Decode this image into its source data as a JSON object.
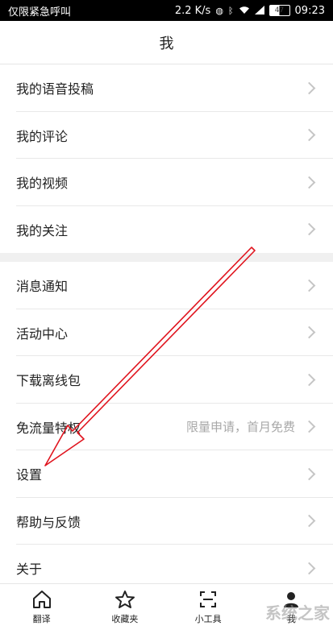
{
  "status_bar": {
    "carrier": "仅限紧急呼叫",
    "speed": "2.2 K/s",
    "battery": "47",
    "time": "09:23"
  },
  "header": {
    "title": "我"
  },
  "menu_group_1": [
    {
      "label": "我的语音投稿"
    },
    {
      "label": "我的评论"
    },
    {
      "label": "我的视频"
    },
    {
      "label": "我的关注"
    }
  ],
  "menu_group_2": [
    {
      "label": "消息通知",
      "sub": ""
    },
    {
      "label": "活动中心",
      "sub": ""
    },
    {
      "label": "下载离线包",
      "sub": ""
    },
    {
      "label": "免流量特权",
      "sub": "限量申请，首月免费"
    },
    {
      "label": "设置",
      "sub": ""
    },
    {
      "label": "帮助与反馈",
      "sub": ""
    },
    {
      "label": "关于",
      "sub": ""
    }
  ],
  "bottom_nav": [
    {
      "label": "翻译",
      "icon": "home-icon"
    },
    {
      "label": "收藏夹",
      "icon": "star-icon"
    },
    {
      "label": "小工具",
      "icon": "scan-icon"
    },
    {
      "label": "我",
      "icon": "profile-icon"
    }
  ],
  "watermark": "系统之家",
  "colors": {
    "arrow": "#e0141e",
    "status_bar_bg": "#000000",
    "section_gap": "#f0f0f0"
  }
}
